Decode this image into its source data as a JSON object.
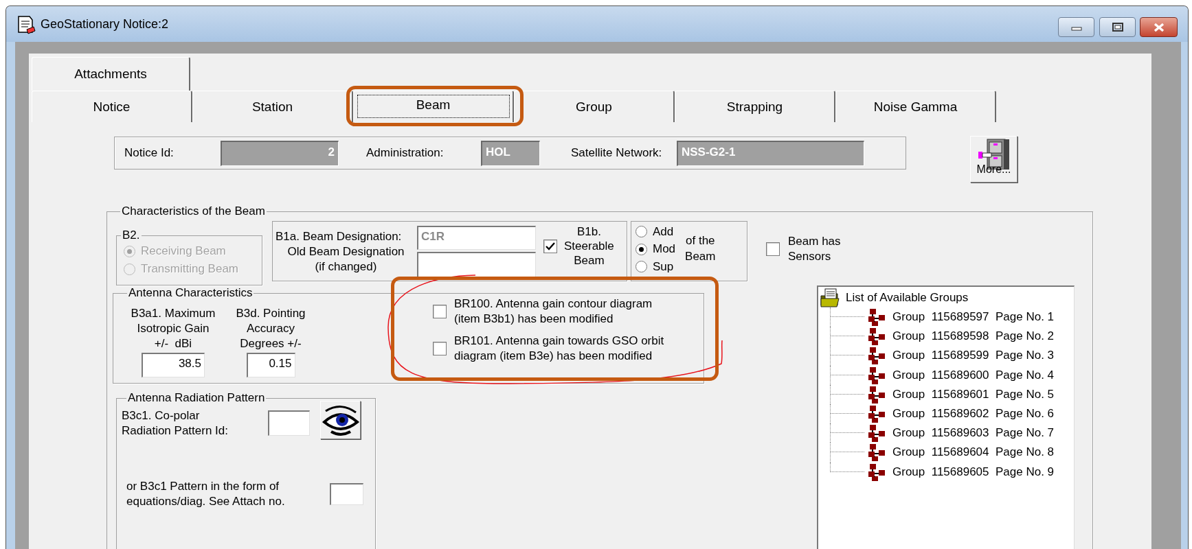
{
  "window": {
    "title": "GeoStationary Notice:2"
  },
  "tab_rows": [
    [
      {
        "label": "Attachments",
        "selected": false
      }
    ],
    [
      {
        "label": "Notice",
        "selected": false
      },
      {
        "label": "Station",
        "selected": false
      },
      {
        "label": "Beam",
        "selected": true
      },
      {
        "label": "Group",
        "selected": false
      },
      {
        "label": "Strapping",
        "selected": false
      },
      {
        "label": "Noise Gamma",
        "selected": false
      }
    ]
  ],
  "header": {
    "fields": [
      {
        "label": "Notice Id:",
        "value": "2"
      },
      {
        "label": "Administration:",
        "value": "HOL"
      },
      {
        "label": "Satellite Network:",
        "value": "NSS-G2-1"
      }
    ],
    "more_button": "More..."
  },
  "beam": {
    "title": "Characteristics of the Beam",
    "b2": {
      "title": "B2.",
      "disabled": true,
      "options": [
        {
          "label": "Receiving Beam",
          "selected": true
        },
        {
          "label": "Transmitting Beam",
          "selected": false
        }
      ]
    },
    "designation": {
      "label": "B1a. Beam Designation:",
      "value": "C1R",
      "old_label": "Old Beam Designation\n(if changed)"
    },
    "steerable": {
      "label": "B1b.\nSteerable\nBeam",
      "checked": true
    },
    "action": {
      "options": [
        {
          "label": "Add",
          "selected": false
        },
        {
          "label": "Mod",
          "selected": true
        },
        {
          "label": "Sup",
          "selected": false
        }
      ],
      "suffix": "of the\nBeam"
    },
    "sensors": {
      "label": "Beam has\nSensors",
      "checked": false
    },
    "antenna": {
      "title": "Antenna Characteristics",
      "fields": [
        {
          "label": "B3a1. Maximum\nIsotropic Gain\n+/-  dBi",
          "value": "38.5"
        },
        {
          "label": "B3d. Pointing\nAccuracy\nDegrees +/-",
          "value": "0.15"
        }
      ],
      "checks": [
        {
          "label": "BR100. Antenna gain contour diagram\n(item B3b1) has been modified",
          "checked": false
        },
        {
          "label": "BR101. Antenna gain towards GSO orbit\ndiagram (item B3e) has been modified",
          "checked": false
        }
      ]
    },
    "radiation": {
      "title": "Antenna Radiation Pattern",
      "pattern_label": "B3c1. Co-polar\nRadiation Pattern Id:",
      "attach_label": "or B3c1 Pattern in the form of\nequations/diag. See Attach no."
    }
  },
  "groups": {
    "title": "List of Available Groups",
    "children": [
      {
        "label": "Group  115689597  Page No. 1"
      },
      {
        "label": "Group  115689598  Page No. 2"
      },
      {
        "label": "Group  115689599  Page No. 3"
      },
      {
        "label": "Group  115689600  Page No. 4"
      },
      {
        "label": "Group  115689601  Page No. 5"
      },
      {
        "label": "Group  115689602  Page No. 6"
      },
      {
        "label": "Group  115689603  Page No. 7"
      },
      {
        "label": "Group  115689604  Page No. 8"
      },
      {
        "label": "Group  115689605  Page No. 9"
      }
    ]
  }
}
